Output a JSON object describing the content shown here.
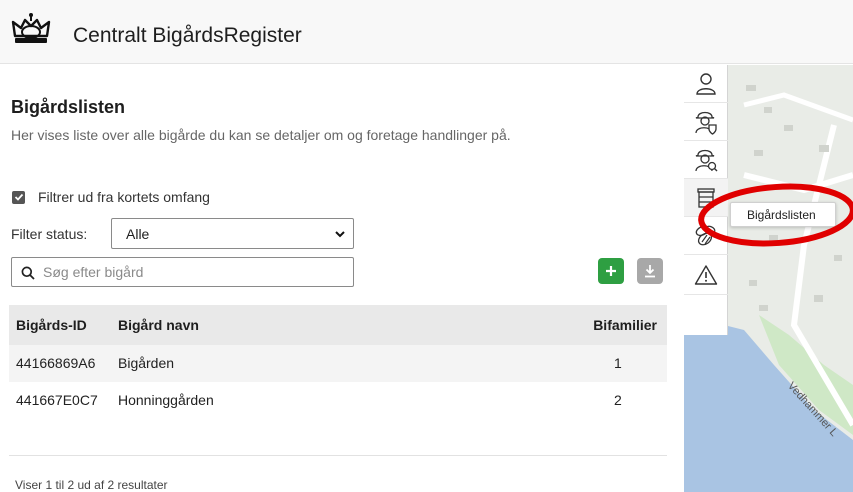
{
  "app": {
    "title": "Centralt BigårdsRegister",
    "logo_icon": "crown-icon"
  },
  "page": {
    "title": "Bigårdslisten",
    "subtitle": "Her vises liste over alle bigårde du kan se detaljer om og foretage handlinger på."
  },
  "filters": {
    "map_extent_label": "Filtrer ud fra kortets omfang",
    "map_extent_checked": true,
    "status_label": "Filter status:",
    "status_value": "Alle"
  },
  "search": {
    "placeholder": "Søg efter bigård",
    "value": ""
  },
  "actions": {
    "add_icon": "plus-icon",
    "download_icon": "download-icon",
    "add_color": "#2e9f42",
    "download_color": "#a8a8a8"
  },
  "table": {
    "columns": [
      "Bigårds-ID",
      "Bigård navn",
      "Bifamilier"
    ],
    "rows": [
      [
        "44166869A6",
        "Bigården",
        "1"
      ],
      [
        "441667E0C7",
        "Honninggården",
        "2"
      ]
    ]
  },
  "footer": {
    "results_text": "Viser 1 til 2 ud af 2 resultater"
  },
  "toolbar": {
    "items": [
      {
        "icon": "person-icon",
        "active": false
      },
      {
        "icon": "beekeeper-shield-icon",
        "active": false
      },
      {
        "icon": "beekeeper-search-icon",
        "active": false
      },
      {
        "icon": "beehive-list-icon",
        "active": true
      },
      {
        "icon": "bee-icon",
        "active": false
      },
      {
        "icon": "warning-icon",
        "active": false
      }
    ]
  },
  "tooltip": {
    "text": "Bigårdslisten"
  },
  "map": {
    "road_label": "Vedhammer L"
  },
  "annotation": {
    "color": "#e00000"
  }
}
